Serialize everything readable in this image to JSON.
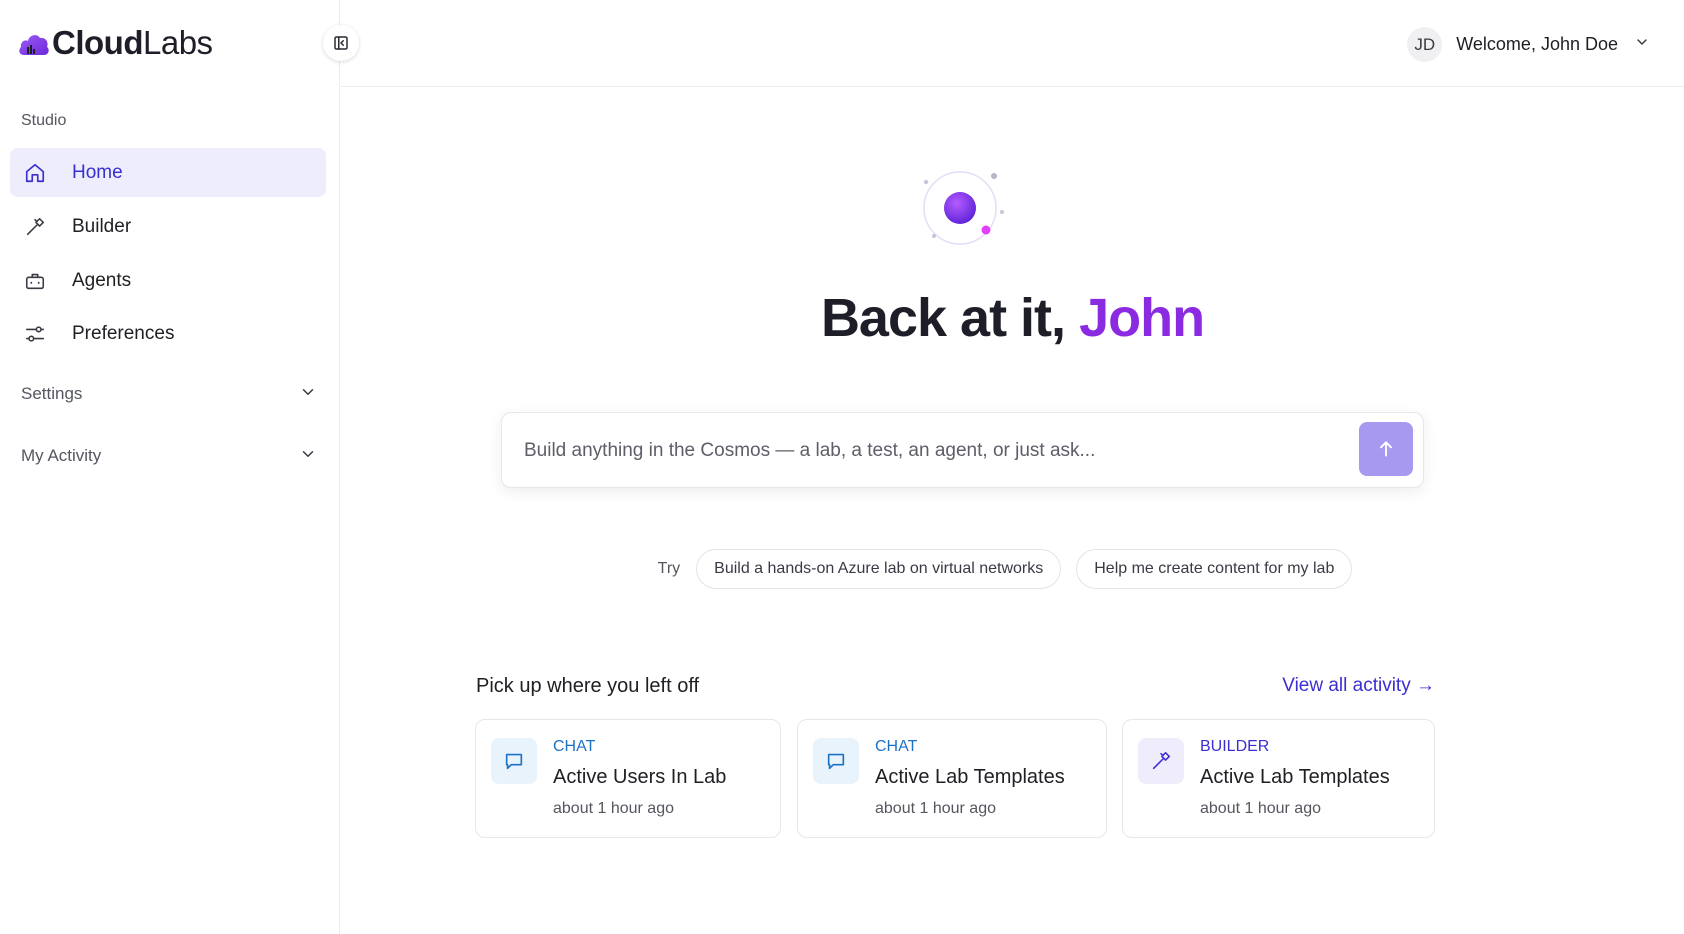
{
  "brand": {
    "logo_bold": "Cloud",
    "logo_light": "Labs",
    "accent": "#7c3aed"
  },
  "sidebar": {
    "section_label": "Studio",
    "items": [
      {
        "label": "Home",
        "icon": "home-icon",
        "active": true
      },
      {
        "label": "Builder",
        "icon": "hammer-icon",
        "active": false
      },
      {
        "label": "Agents",
        "icon": "briefcase-icon",
        "active": false
      },
      {
        "label": "Preferences",
        "icon": "sliders-icon",
        "active": false
      }
    ],
    "collapsibles": [
      {
        "label": "Settings",
        "icon": "chevron-down-icon"
      },
      {
        "label": "My Activity",
        "icon": "chevron-down-icon"
      }
    ]
  },
  "header": {
    "avatar_initials": "JD",
    "welcome": "Welcome, John Doe"
  },
  "hero": {
    "greeting": "Back at it,",
    "name": "John",
    "name_color": "#8a2be2"
  },
  "prompt": {
    "placeholder": "Build anything in the Cosmos — a lab, a test, an agent, or just ask...",
    "send_button_color": "#a899f0"
  },
  "suggestions": {
    "label": "Try",
    "chips": [
      "Build a hands-on Azure lab on virtual networks",
      "Help me create content for my lab"
    ]
  },
  "activity": {
    "heading": "Pick up where you left off",
    "view_all": "View all activity →",
    "cards": [
      {
        "type": "CHAT",
        "title": "Active Users In Lab",
        "time": "about 1 hour ago",
        "icon": "chat-icon"
      },
      {
        "type": "CHAT",
        "title": "Active Lab Templates",
        "time": "about 1 hour ago",
        "icon": "chat-icon"
      },
      {
        "type": "BUILDER",
        "title": "Active Lab Templates",
        "time": "about 1 hour ago",
        "icon": "hammer-icon"
      }
    ]
  }
}
